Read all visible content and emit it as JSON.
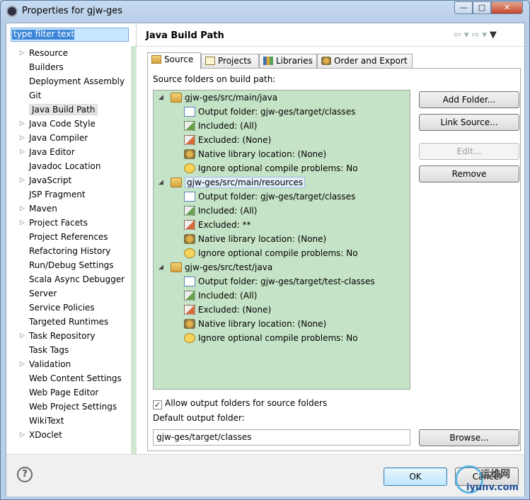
{
  "window": {
    "title": "Properties for gjw-ges",
    "min": "—",
    "max": "□",
    "close": "✕"
  },
  "filter": {
    "placeholder": "type filter text"
  },
  "nav": [
    {
      "label": "Resource",
      "expand": true
    },
    {
      "label": "Builders",
      "expand": false
    },
    {
      "label": "Deployment Assembly",
      "expand": false
    },
    {
      "label": "Git",
      "expand": false
    },
    {
      "label": "Java Build Path",
      "expand": false,
      "selected": true
    },
    {
      "label": "Java Code Style",
      "expand": true
    },
    {
      "label": "Java Compiler",
      "expand": true
    },
    {
      "label": "Java Editor",
      "expand": true
    },
    {
      "label": "Javadoc Location",
      "expand": false
    },
    {
      "label": "JavaScript",
      "expand": true
    },
    {
      "label": "JSP Fragment",
      "expand": false
    },
    {
      "label": "Maven",
      "expand": true
    },
    {
      "label": "Project Facets",
      "expand": true
    },
    {
      "label": "Project References",
      "expand": false
    },
    {
      "label": "Refactoring History",
      "expand": false
    },
    {
      "label": "Run/Debug Settings",
      "expand": false
    },
    {
      "label": "Scala Async Debugger",
      "expand": false
    },
    {
      "label": "Server",
      "expand": false
    },
    {
      "label": "Service Policies",
      "expand": false
    },
    {
      "label": "Targeted Runtimes",
      "expand": false
    },
    {
      "label": "Task Repository",
      "expand": true
    },
    {
      "label": "Task Tags",
      "expand": false
    },
    {
      "label": "Validation",
      "expand": true
    },
    {
      "label": "Web Content Settings",
      "expand": false
    },
    {
      "label": "Web Page Editor",
      "expand": false
    },
    {
      "label": "Web Project Settings",
      "expand": false
    },
    {
      "label": "WikiText",
      "expand": false
    },
    {
      "label": "XDoclet",
      "expand": true
    }
  ],
  "page": {
    "title": "Java Build Path"
  },
  "tabs": [
    "Source",
    "Projects",
    "Libraries",
    "Order and Export"
  ],
  "source": {
    "label": "Source folders on build path:",
    "folders": [
      {
        "path": "gjw-ges/src/main/java",
        "output": "Output folder: gjw-ges/target/classes",
        "included": "Included: (All)",
        "excluded": "Excluded: (None)",
        "native": "Native library location: (None)",
        "ignore": "Ignore optional compile problems: No"
      },
      {
        "path": "gjw-ges/src/main/resources",
        "output": "Output folder: gjw-ges/target/classes",
        "included": "Included: (All)",
        "excluded": "Excluded: **",
        "native": "Native library location: (None)",
        "ignore": "Ignore optional compile problems: No"
      },
      {
        "path": "gjw-ges/src/test/java",
        "output": "Output folder: gjw-ges/target/test-classes",
        "included": "Included: (All)",
        "excluded": "Excluded: (None)",
        "native": "Native library location: (None)",
        "ignore": "Ignore optional compile problems: No"
      }
    ],
    "buttons": {
      "add": "Add Folder...",
      "link": "Link Source...",
      "edit": "Edit...",
      "remove": "Remove"
    },
    "allow_output": "Allow output folders for source folders",
    "default_output_label": "Default output folder:",
    "default_output_value": "gjw-ges/target/classes",
    "browse": "Browse..."
  },
  "footer": {
    "help": "?",
    "ok": "OK",
    "cancel": "Cancel"
  },
  "watermark": {
    "line1": "运维网",
    "line2": "iyunv.com"
  }
}
